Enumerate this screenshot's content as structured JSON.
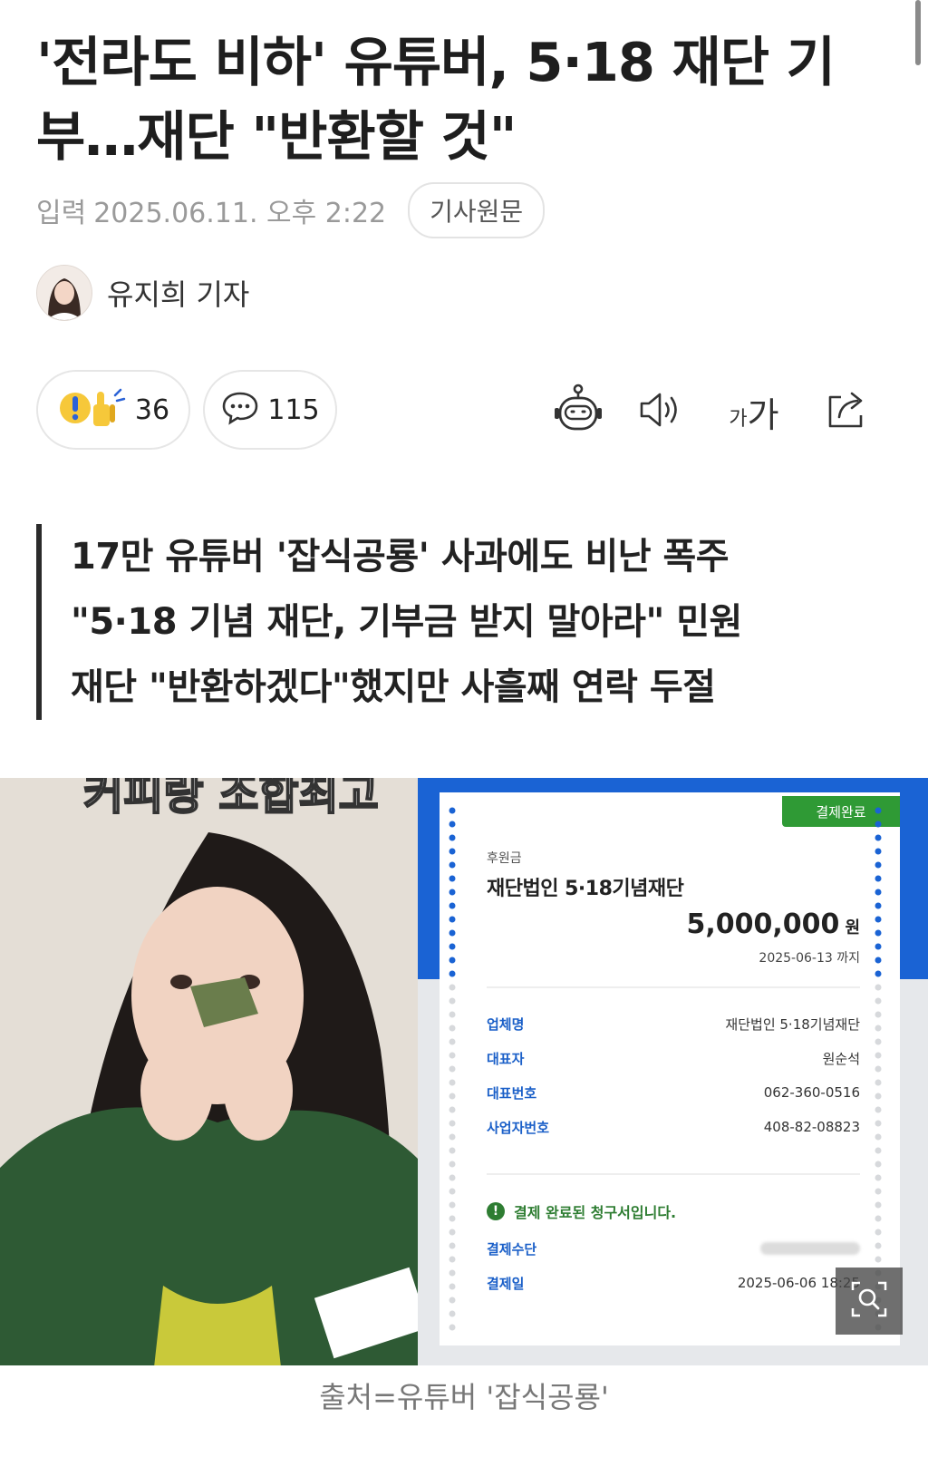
{
  "article": {
    "title": "'전라도 비하' 유튜버, 5·18 재단 기부…재단 \"반환할 것\"",
    "published_label": "입력",
    "published_date": "2025.06.11. 오후 2:22",
    "original_link_label": "기사원문",
    "reporter": "유지희 기자"
  },
  "actions": {
    "reaction_count": "36",
    "comment_count": "115",
    "summary_bot_icon": "robot-icon",
    "tts_icon": "speaker-icon",
    "font_size_label_small": "가",
    "font_size_label_big": "가",
    "share_icon": "share-icon"
  },
  "summary": [
    "17만 유튜버 '잡식공룡' 사과에도 비난 폭주",
    "\"5·18 기념 재단, 기부금 받지 말아라\" 민원",
    "재단 \"반환하겠다\"했지만 사흘째 연락 두절"
  ],
  "photo": {
    "overlay_text": "커피랑 조합최고",
    "receipt": {
      "badge": "결제완료",
      "category": "후원금",
      "org_name": "재단법인 5·18기념재단",
      "amount": "5,000,000",
      "amount_unit": "원",
      "due": "2025-06-13 까지",
      "rows": [
        {
          "key": "업체명",
          "value": "재단법인 5·18기념재단"
        },
        {
          "key": "대표자",
          "value": "원순석"
        },
        {
          "key": "대표번호",
          "value": "062-360-0516"
        },
        {
          "key": "사업자번호",
          "value": "408-82-08823"
        }
      ],
      "notice": "결제 완료된 청구서입니다.",
      "pay_method_label": "결제수단",
      "pay_date_label": "결제일",
      "pay_date": "2025-06-06 18:25"
    },
    "zoom_icon": "zoom-icon"
  },
  "caption": "출처=유튜버 '잡식공룡'",
  "colors": {
    "receipt_blue": "#1a63d4",
    "paid_green": "#2f9a35",
    "key_blue": "#1a5fc8"
  }
}
